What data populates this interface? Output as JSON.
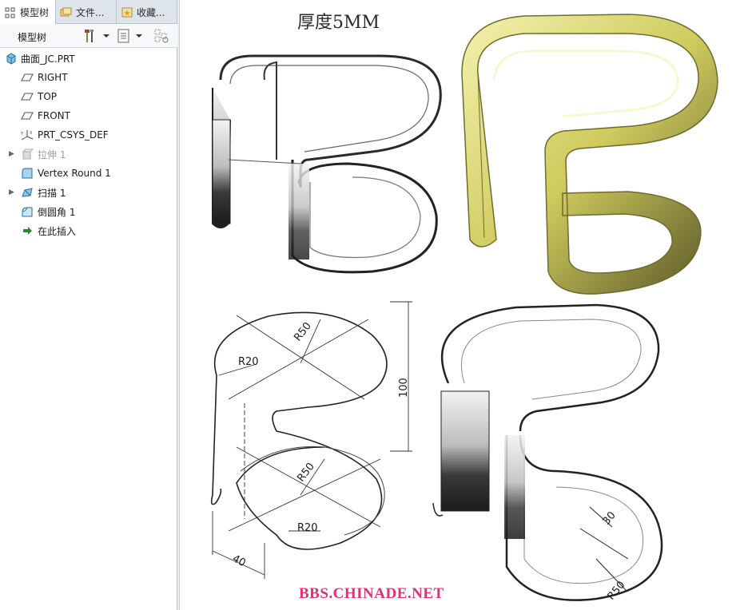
{
  "tabs": [
    {
      "label": "模型树"
    },
    {
      "label": "文件..."
    },
    {
      "label": "收藏..."
    }
  ],
  "toolbar": {
    "title": "模型树"
  },
  "tree": {
    "root": "曲面_JC.PRT",
    "items": [
      {
        "label": "RIGHT"
      },
      {
        "label": "TOP"
      },
      {
        "label": "FRONT"
      },
      {
        "label": "PRT_CSYS_DEF"
      },
      {
        "label": "拉伸 1"
      },
      {
        "label": "Vertex Round 1"
      },
      {
        "label": "扫描 1"
      },
      {
        "label": "倒圆角 1"
      },
      {
        "label": "在此插入"
      }
    ]
  },
  "canvas": {
    "title": "厚度5MM",
    "watermark": "BBS.CHINADE.NET",
    "dimensions": {
      "r50_top": "R50",
      "r20_top": "R20",
      "height": "100",
      "r50_bottom": "R50",
      "r20_bottom": "R20",
      "width": "40",
      "dim30": "30",
      "r50_right": "R50"
    }
  },
  "colors": {
    "tab_bar": "#dde4ec",
    "panel_border": "#b9c3cf",
    "model_yellow": "#d9d77a",
    "watermark": "#e0336d"
  }
}
